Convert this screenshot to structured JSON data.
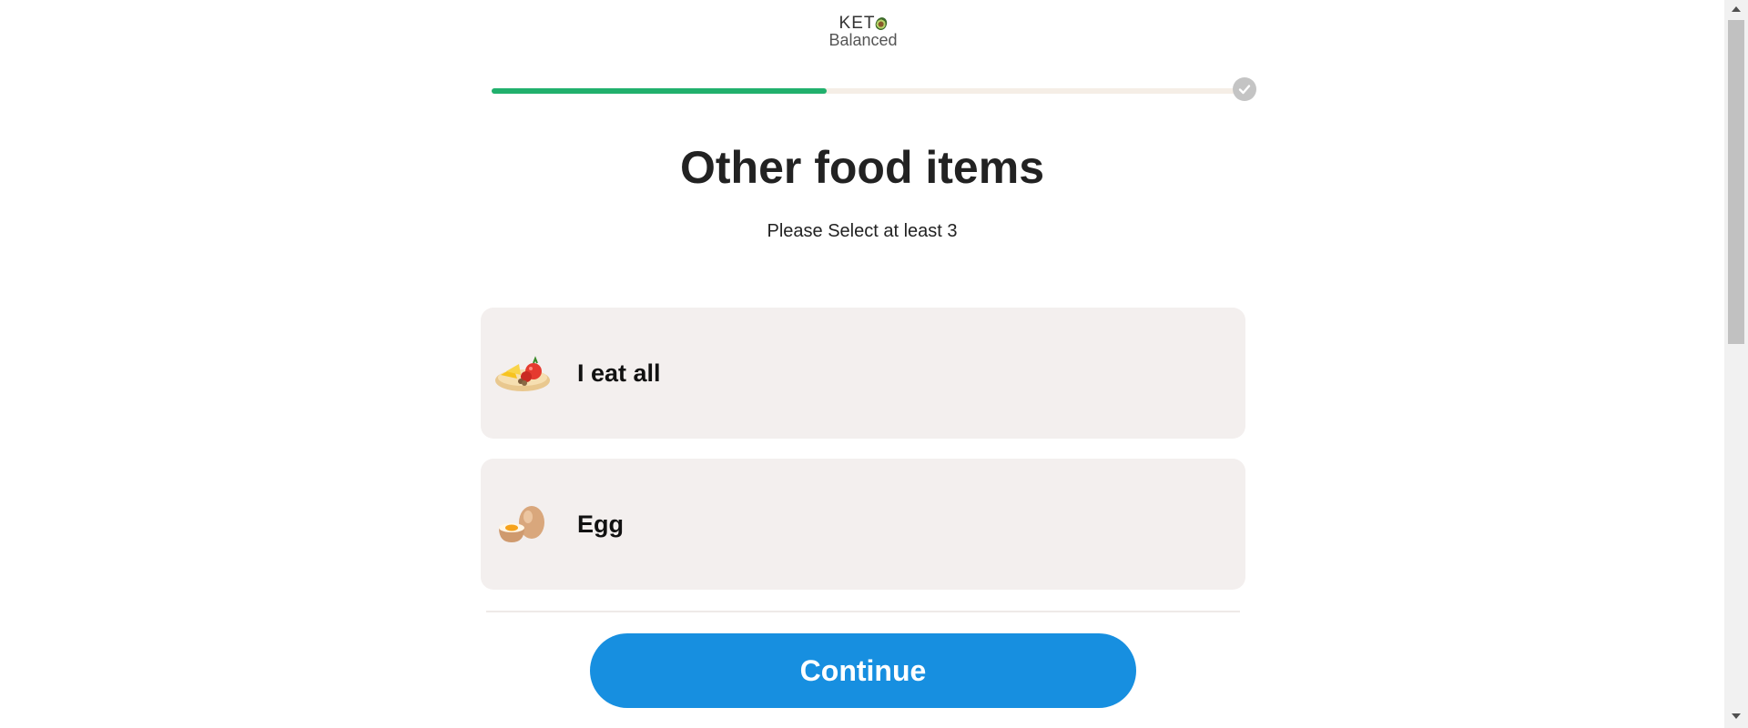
{
  "logo": {
    "line1": "KET",
    "line2": "Balanced"
  },
  "progress": {
    "fraction": 0.445,
    "fill_color": "#21b06d",
    "track_color": "#f5eee6",
    "end_icon": "check-circle-icon"
  },
  "header": {
    "title": "Other food items",
    "subtitle": "Please Select at least 3"
  },
  "options": [
    {
      "label": "I eat all",
      "icon": "food-platter-icon"
    },
    {
      "label": "Egg",
      "icon": "egg-icon"
    }
  ],
  "actions": {
    "continue_label": "Continue",
    "button_color": "#178fe0"
  }
}
